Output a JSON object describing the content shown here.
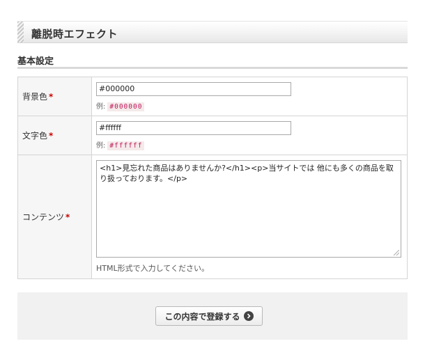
{
  "page": {
    "title": "離脱時エフェクト"
  },
  "section": {
    "title": "基本設定"
  },
  "form": {
    "required_mark": "*",
    "example_prefix": "例:",
    "background_color": {
      "label": "背景色",
      "value": "#000000",
      "example": "#000000"
    },
    "text_color": {
      "label": "文字色",
      "value": "#ffffff",
      "example": "#ffffff"
    },
    "content": {
      "label": "コンテンツ",
      "value": "<h1>見忘れた商品はありませんか?</h1><p>当サイトでは 他にも多くの商品を取り扱っております。</p>",
      "help": "HTML形式で入力してください。"
    }
  },
  "actions": {
    "submit_label": "この内容で登録する",
    "submit_icon": "arrow-right-circle-icon"
  },
  "colors": {
    "required": "#cc0000",
    "example_text": "#c2185b",
    "example_bg": "#f4eaea",
    "action_bg": "#f1f1f1"
  }
}
